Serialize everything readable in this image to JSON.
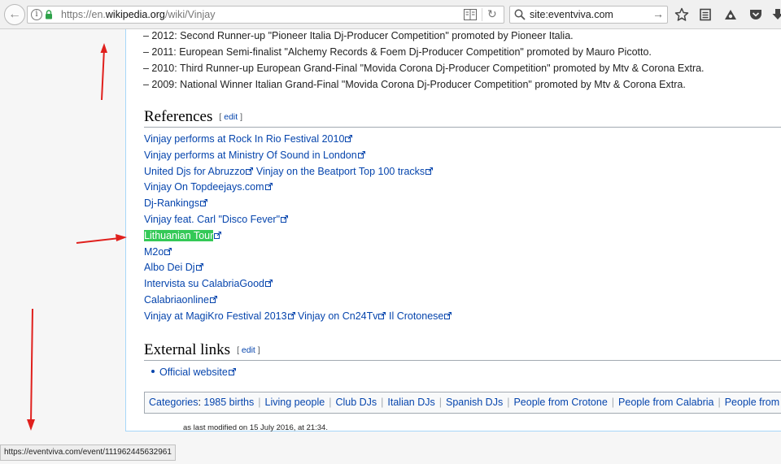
{
  "browser": {
    "url_prefix": "https://en.",
    "url_host": "wikipedia.org",
    "url_path": "/wiki/Vinjay",
    "search_value": "site:eventviva.com"
  },
  "awards": [
    "– 2012: Second Runner-up \"Pioneer Italia Dj-Producer Competition\" promoted by Pioneer Italia.",
    "– 2011: European Semi-finalist \"Alchemy Records & Foem Dj-Producer Competition\" promoted by Mauro Picotto.",
    "– 2010: Third Runner-up European Grand-Final \"Movida Corona Dj-Producer Competition\" promoted by Mtv & Corona Extra.",
    "– 2009: National Winner Italian Grand-Final \"Movida Corona Dj-Producer Competition\" promoted by Mtv & Corona Extra."
  ],
  "references": {
    "heading": "References",
    "edit_open": "[",
    "edit_label": "edit",
    "edit_close": "]",
    "rows": [
      [
        "Vinjay performs at Rock In Rio Festival 2010"
      ],
      [
        "Vinjay performs at Ministry Of Sound in London"
      ],
      [
        "United Djs for Abruzzo",
        "Vinjay on the Beatport Top 100 tracks"
      ],
      [
        "Vinjay On Topdeejays.com"
      ],
      [
        "Dj-Rankings"
      ],
      [
        "Vinjay feat. Carl \"Disco Fever\""
      ],
      [
        "Lithuanian Tour"
      ],
      [
        "M2o"
      ],
      [
        "Albo Dei Dj"
      ],
      [
        "Intervista su CalabriaGood"
      ],
      [
        "Calabriaonline"
      ],
      [
        "Vinjay at MagiKro Festival 2013",
        "Vinjay on Cn24Tv",
        "Il Crotonese"
      ]
    ],
    "highlighted": "Lithuanian Tour"
  },
  "external_links": {
    "heading": "External links",
    "edit_open": "[",
    "edit_label": "edit",
    "edit_close": "]",
    "official_website": "Official website"
  },
  "categories": {
    "label": "Categories",
    "items": [
      "1985 births",
      "Living people",
      "Club DJs",
      "Italian DJs",
      "Spanish DJs",
      "People from Crotone",
      "People from Calabria",
      "People from"
    ]
  },
  "footer": {
    "modified_text": "as last modified on 15 July 2016, at 21:34."
  },
  "status_bar": {
    "link_url": "https://eventviva.com/event/111962445632961"
  },
  "colors": {
    "link": "#0645ad",
    "highlight": "#34c957",
    "annotation_arrow": "#e0201d"
  }
}
